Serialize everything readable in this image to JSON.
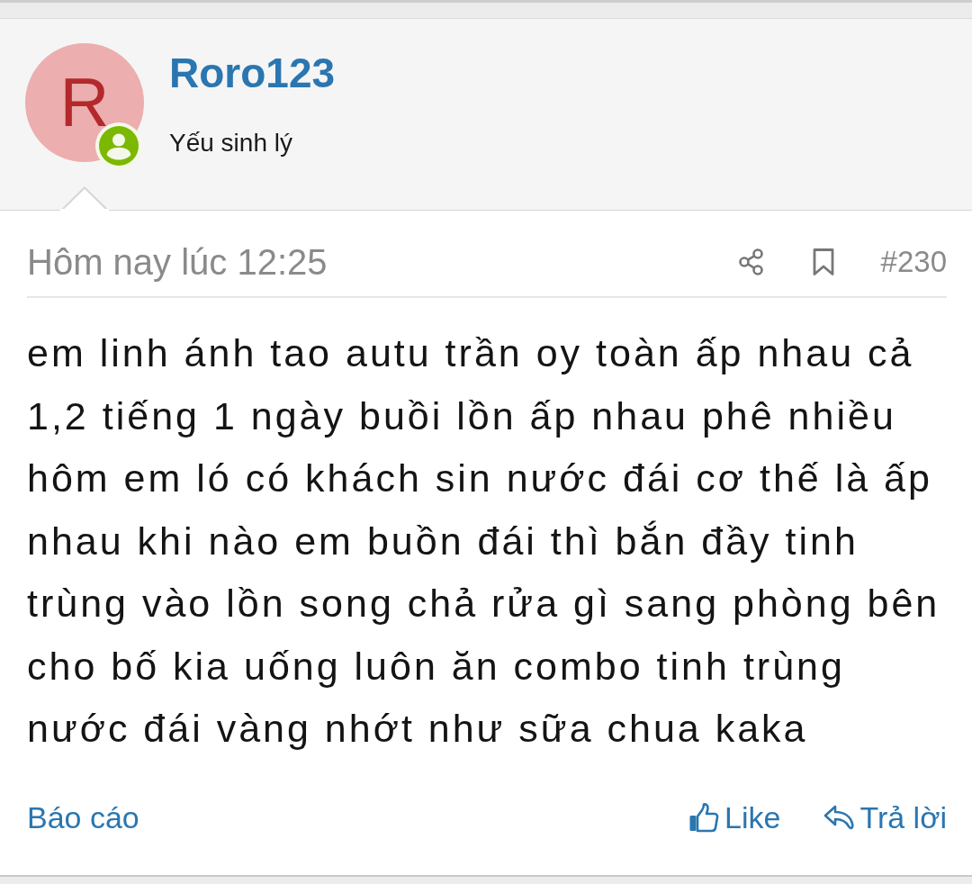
{
  "post": {
    "author": {
      "avatar_letter": "R",
      "name": "Roro123",
      "title": "Yếu sinh lý"
    },
    "meta": {
      "time": "Hôm nay lúc 12:25",
      "number": "#230"
    },
    "body": "em linh ánh tao autu trần oy toàn ấp nhau cả 1,2 tiếng 1 ngày buồi lồn ấp nhau phê nhiều hôm em ló có khách sin nước đái cơ thế là ấp nhau khi nào em buồn đái thì bắn đầy tinh trùng vào lồn song chả rửa gì sang phòng bên cho bố kia uống luôn ăn combo tinh trùng nước đái vàng nhớt như sữa chua kaka",
    "actions": {
      "report": "Báo cáo",
      "like": "Like",
      "reply": "Trả lời"
    }
  }
}
